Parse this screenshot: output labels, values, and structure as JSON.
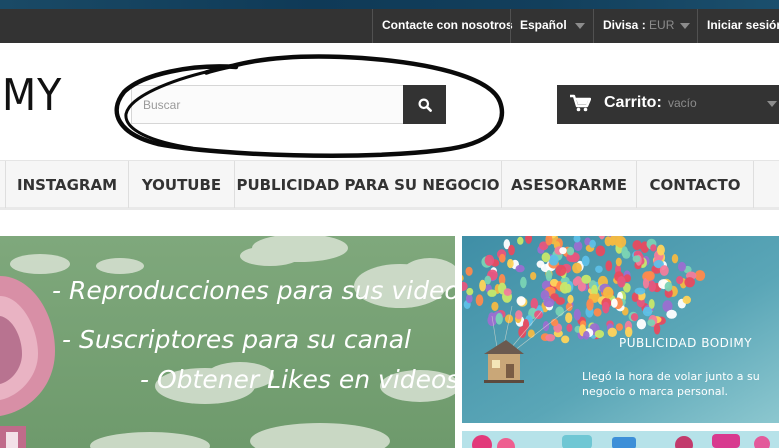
{
  "topbar": {
    "contact": "Contacte con nosotros",
    "language": "Español",
    "currency_label": "Divisa :",
    "currency_value": "EUR",
    "login": "Iniciar sesión"
  },
  "logo": {
    "text": "MY"
  },
  "search": {
    "placeholder": "Buscar",
    "value": ""
  },
  "cart": {
    "label": "Carrito:",
    "status": "vacío"
  },
  "menu": {
    "items": [
      {
        "label": "INSTAGRAM"
      },
      {
        "label": "YOUTUBE"
      },
      {
        "label": "PUBLICIDAD PARA SU NEGOCIO"
      },
      {
        "label": "ASESORARME"
      },
      {
        "label": "CONTACTO"
      }
    ]
  },
  "banner_left": {
    "lines": [
      "- Reproducciones para sus videos",
      "- Suscriptores para su canal",
      "- Obtener Likes en videos"
    ]
  },
  "banner_right": {
    "title": "PUBLICIDAD BODIMY",
    "subtitle": "Llegó la hora de volar junto a su negocio o marca personal."
  },
  "colors": {
    "dark": "#333333",
    "muted": "#8c8c8c",
    "menu_bg": "#f6f6f6",
    "banner_green": "#7ea47c",
    "banner_blue": "#5aa1b3"
  },
  "icons": {
    "search": "search-icon",
    "cart": "cart-icon",
    "caret": "caret-down-icon"
  }
}
